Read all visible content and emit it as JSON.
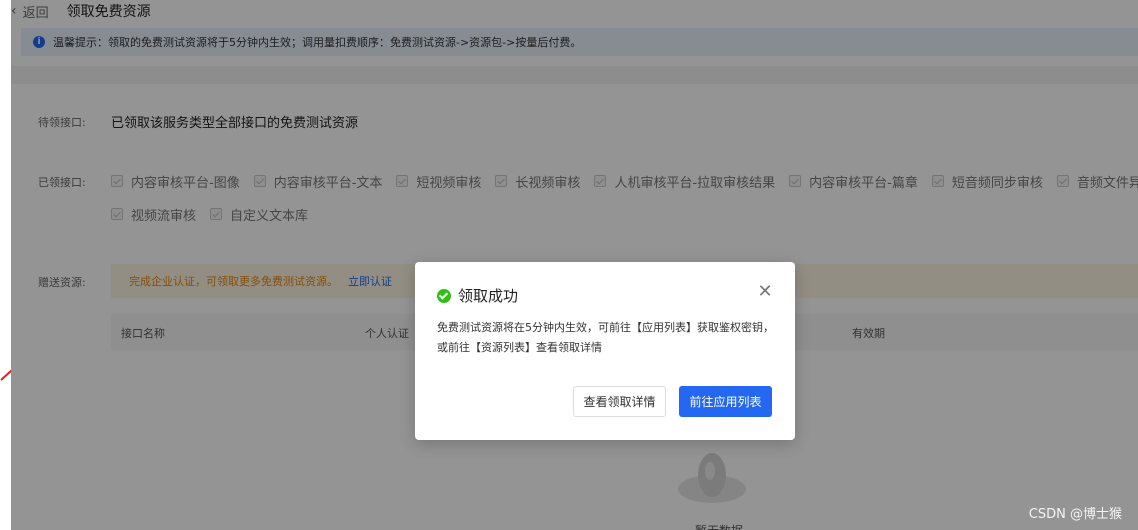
{
  "header": {
    "back_label": "返回",
    "title": "领取免费资源"
  },
  "notice": {
    "text": "温馨提示：领取的免费测试资源将于5分钟内生效；调用量扣费顺序：免费测试资源->资源包->按量后付费。"
  },
  "pending": {
    "label": "待领接口:",
    "value": "已领取该服务类型全部接口的免费测试资源"
  },
  "claimed": {
    "label": "已领接口:",
    "row1": [
      "内容审核平台-图像",
      "内容审核平台-文本",
      "短视频审核",
      "长视频审核",
      "人机审核平台-拉取审核结果",
      "内容审核平台-篇章",
      "短音频同步审核",
      "音频文件异"
    ],
    "row2": [
      "视频流审核",
      "自定义文本库"
    ]
  },
  "gift": {
    "label": "赠送资源:",
    "text": "完成企业认证，可领取更多免费测试资源。",
    "link": "立即认证"
  },
  "table": {
    "headers": [
      "接口名称",
      "个人认证",
      "有效期"
    ]
  },
  "empty": {
    "text": "暂无数据"
  },
  "modal": {
    "title": "领取成功",
    "body": "免费测试资源将在5分钟内生效，可前往【应用列表】获取鉴权密钥，或前往【资源列表】查看领取详情",
    "secondary_button": "查看领取详情",
    "primary_button": "前往应用列表",
    "close_icon": "close-icon",
    "status_icon": "success-check-icon"
  },
  "watermark": "CSDN @博士猴",
  "colors": {
    "primary": "#2468f2",
    "success": "#30bf13",
    "warning_text": "#e6870e",
    "notice_bg": "#e9f1fd"
  }
}
